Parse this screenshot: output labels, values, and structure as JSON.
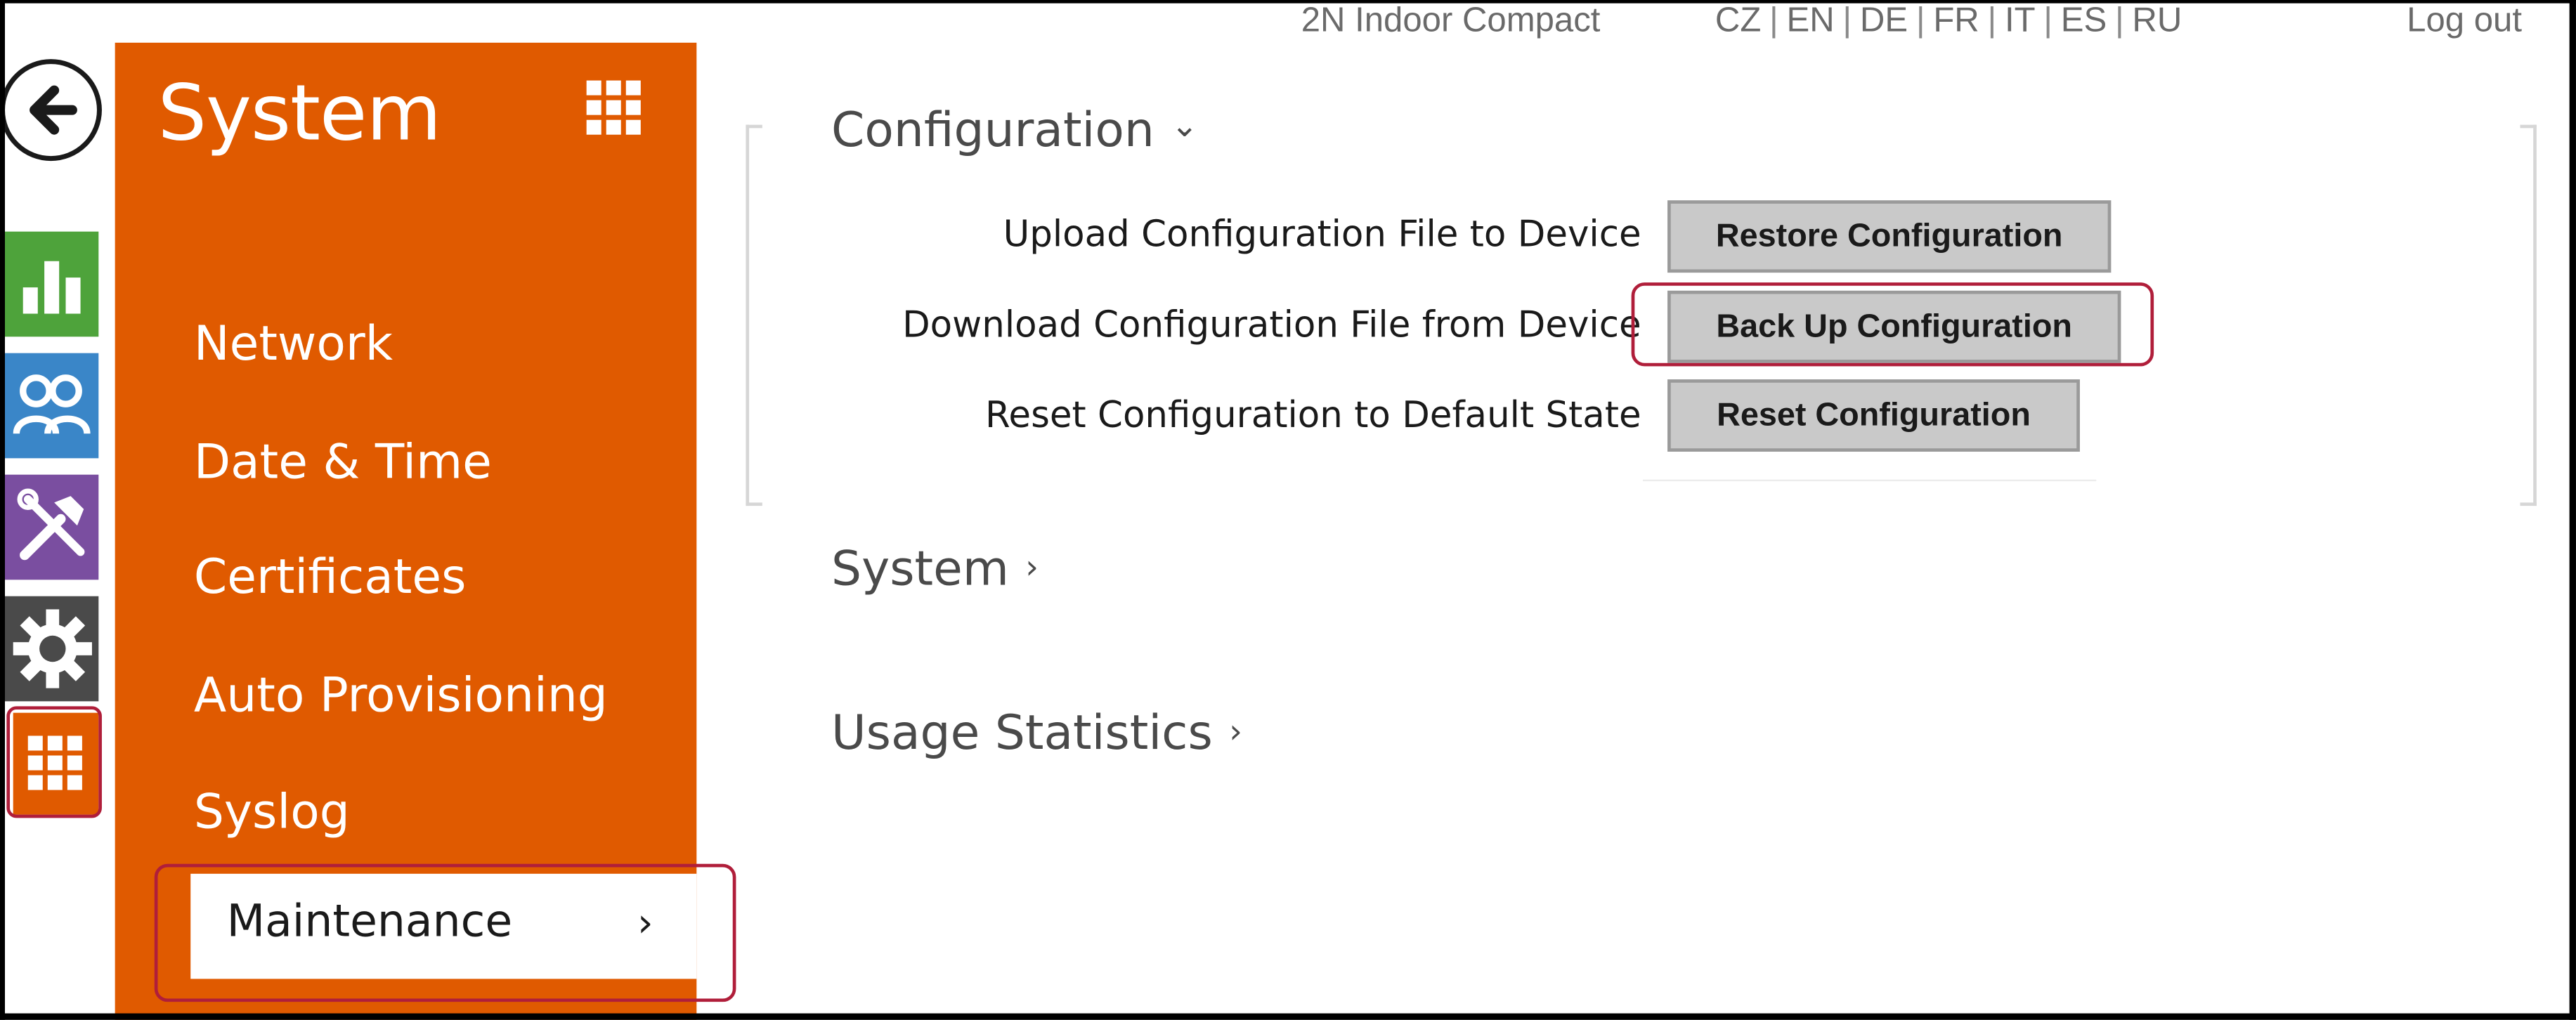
{
  "topbar": {
    "device_name": "2N Indoor Compact",
    "languages": [
      "CZ",
      "EN",
      "DE",
      "FR",
      "IT",
      "ES",
      "RU"
    ],
    "language_separator": "|",
    "logout_label": "Log out"
  },
  "rail": {
    "items": [
      {
        "icon": "back-arrow-icon"
      },
      {
        "icon": "bar-chart-icon",
        "color": "#4ea33b"
      },
      {
        "icon": "users-icon",
        "color": "#3a86c8"
      },
      {
        "icon": "tools-icon",
        "color": "#7a4ea0"
      },
      {
        "icon": "gear-icon",
        "color": "#4a4a4a"
      },
      {
        "icon": "grid-icon",
        "color": "#e05a00"
      }
    ]
  },
  "sidebar": {
    "title": "System",
    "title_icon": "grid-icon",
    "items": [
      {
        "label": "Network"
      },
      {
        "label": "Date & Time"
      },
      {
        "label": "Certificates"
      },
      {
        "label": "Auto Provisioning"
      },
      {
        "label": "Syslog"
      }
    ],
    "active_item": {
      "label": "Maintenance",
      "chevron": "›"
    }
  },
  "main": {
    "configuration": {
      "title": "Configuration",
      "chevron": "⌄",
      "rows": [
        {
          "label": "Upload Configuration File to Device",
          "button": "Restore Configuration"
        },
        {
          "label": "Download Configuration File from Device",
          "button": "Back Up Configuration"
        },
        {
          "label": "Reset Configuration to Default State",
          "button": "Reset Configuration"
        }
      ]
    },
    "system_section": {
      "title": "System",
      "chevron": "›"
    },
    "usage_section": {
      "title": "Usage Statistics",
      "chevron": "›"
    }
  },
  "colors": {
    "accent": "#e05a00",
    "highlight": "#b01e3a",
    "button_bg": "#c9c9c9"
  }
}
